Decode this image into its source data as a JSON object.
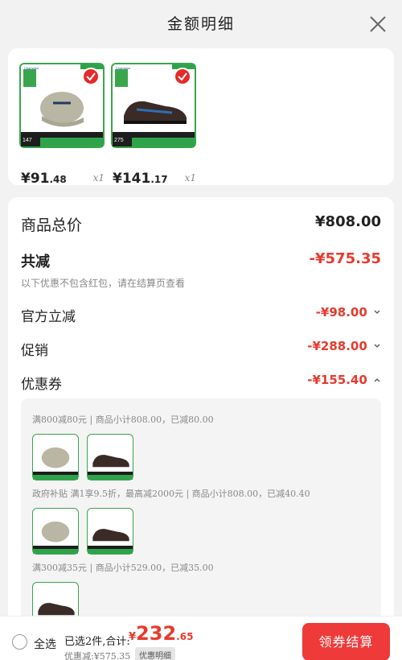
{
  "header": {
    "title": "金额明细"
  },
  "products": [
    {
      "price_int": "¥91",
      "price_cents": ".48",
      "qty": "x1",
      "thumb_price": "147"
    },
    {
      "price_int": "¥141",
      "price_cents": ".17",
      "qty": "x1",
      "thumb_price": "275"
    }
  ],
  "summary": {
    "goods_total_label": "商品总价",
    "goods_total_value": "¥808.00",
    "total_discount_label": "共减",
    "total_discount_value": "-¥575.35",
    "note": "以下优惠不包含红包，请在结算页查看",
    "official_label": "官方立减",
    "official_value": "-¥98.00",
    "promo_label": "促销",
    "promo_value": "-¥288.00",
    "coupon_label": "优惠券",
    "coupon_value": "-¥155.40"
  },
  "coupon_details": [
    {
      "text": "满800减80元 | 商品小计808.00，已减80.00"
    },
    {
      "text": "政府补贴 满1享9.5折，最高减2000元 | 商品小计808.00，已减40.40"
    },
    {
      "text": "满300减35元 | 商品小计529.00，已减35.00"
    }
  ],
  "footer": {
    "select_all": "全选",
    "selected_text": "已选2件,合计:",
    "total_yen": "¥",
    "total_int": "232",
    "total_cents": ".65",
    "discount_text": "优惠减:¥575.35",
    "discount_button": "优惠明细",
    "checkout_button": "领券结算"
  },
  "colors": {
    "accent": "#e63b2e",
    "checkout": "#ee3a39",
    "thumb_green": "#2fa34a"
  },
  "icons": [
    "close-icon",
    "check-icon",
    "chevron-down-icon",
    "chevron-up-icon"
  ]
}
